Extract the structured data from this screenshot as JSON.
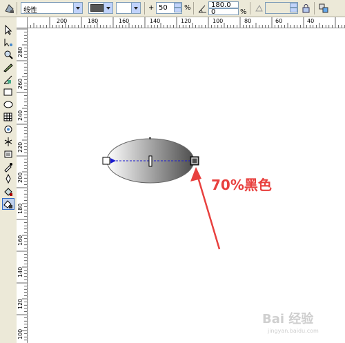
{
  "propbar": {
    "fill_type": "线性",
    "midpoint_value": "50",
    "percent_symbol": "%",
    "angle_value": "180.0",
    "edge_pad_value": "0",
    "color_swatch": "#555555"
  },
  "ruler": {
    "h_labels": [
      "200",
      "180",
      "160",
      "140",
      "120",
      "100",
      "80",
      "60",
      "40"
    ],
    "v_labels": [
      "280",
      "260",
      "240",
      "220",
      "200",
      "180",
      "160",
      "140",
      "120",
      "100"
    ]
  },
  "tools": [
    "pick-tool",
    "shape-tool",
    "zoom-tool",
    "freehand-tool",
    "smart-fill-tool",
    "rectangle-tool",
    "ellipse-tool",
    "polygon-tool",
    "basic-shapes-tool",
    "text-tool",
    "interactive-blend-tool",
    "eyedropper-tool",
    "outline-tool",
    "fill-tool",
    "interactive-fill-tool"
  ],
  "annotation": {
    "text": "70%黑色",
    "color": "#e8403e"
  },
  "gradient": {
    "start_color": "#ffffff",
    "end_color": "#4d4d4d",
    "accent": "#1a1ad0"
  },
  "watermark": {
    "text": "Bai 经验",
    "url": "jingyan.baidu.com"
  }
}
